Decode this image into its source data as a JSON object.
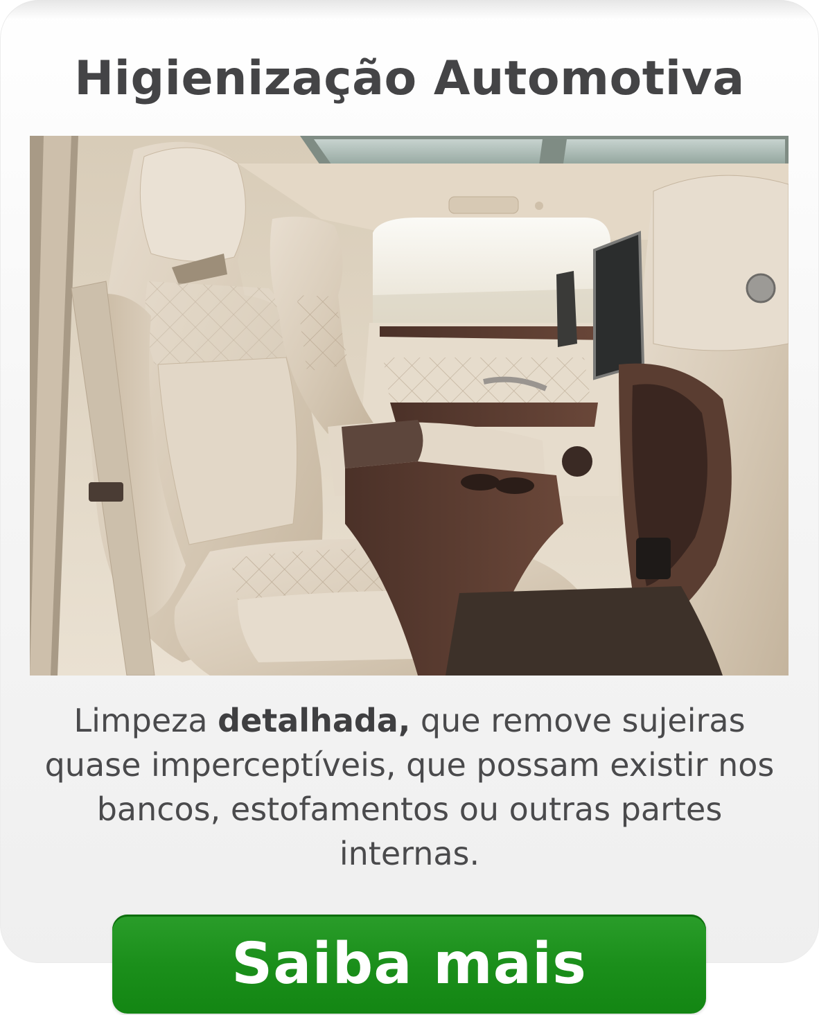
{
  "card": {
    "title": "Higienização Automotiva",
    "image_alt": "Interior de carro de luxo com bancos de couro bege",
    "description": {
      "part1": "Limpeza ",
      "bold": "detalhada,",
      "part2": " que remove sujeiras quase imperceptíveis, que possam existir nos bancos, estofamentos ou outras partes internas."
    },
    "cta_label": "Saiba mais"
  },
  "colors": {
    "title": "#444446",
    "text": "#4a4a4c",
    "cta_bg": "#1b8f1b",
    "cta_text": "#ffffff",
    "card_bg": "#f4f4f4"
  }
}
